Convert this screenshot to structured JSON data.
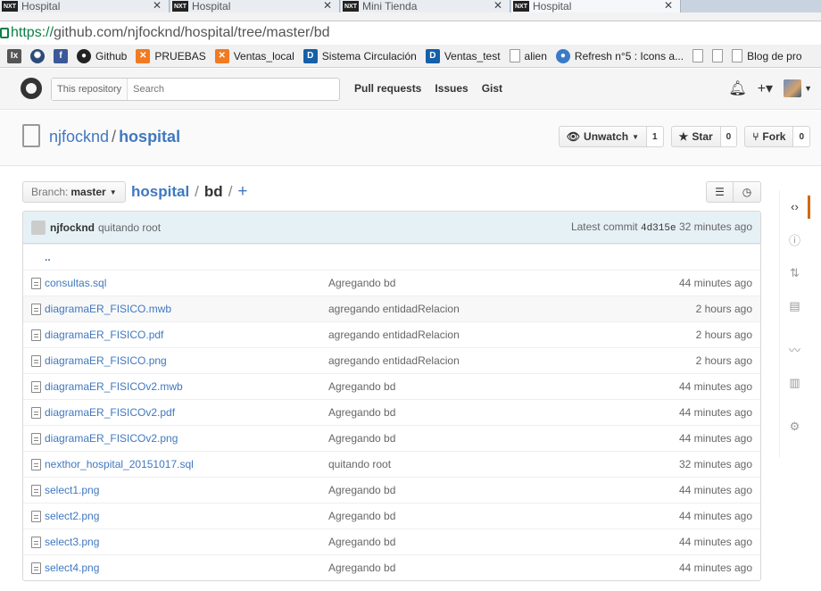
{
  "browser": {
    "tabs": [
      {
        "label": "Hospital",
        "favicon": "NXT"
      },
      {
        "label": "Hospital",
        "favicon": "NXT"
      },
      {
        "label": "Mini Tienda",
        "favicon": "NXT"
      },
      {
        "label": "Hospital",
        "favicon": "NXT"
      }
    ],
    "url_scheme": "https://",
    "url_rest": "github.com/njfocknd/hospital/tree/master/bd",
    "bookmarks": [
      {
        "label": "",
        "icon": "ix-icon"
      },
      {
        "label": "",
        "icon": "globe-icon"
      },
      {
        "label": "",
        "icon": "facebook-icon"
      },
      {
        "label": "Github",
        "icon": "github-icon"
      },
      {
        "label": "PRUEBAS",
        "icon": "xampp-icon"
      },
      {
        "label": "Ventas_local",
        "icon": "xampp-icon"
      },
      {
        "label": "Sistema Circulación",
        "icon": "d-icon"
      },
      {
        "label": "Ventas_test",
        "icon": "d-icon"
      },
      {
        "label": "alien",
        "icon": "page-icon"
      },
      {
        "label": "Refresh n°5 : Icons a...",
        "icon": "globe-icon"
      },
      {
        "label": "",
        "icon": "page-icon"
      },
      {
        "label": "",
        "icon": "page-icon"
      },
      {
        "label": "Blog de pro",
        "icon": "page-icon"
      }
    ]
  },
  "header": {
    "search_scope": "This repository",
    "search_placeholder": "Search",
    "nav": [
      "Pull requests",
      "Issues",
      "Gist"
    ]
  },
  "repo": {
    "owner": "njfocknd",
    "separator": "/",
    "name": "hospital",
    "unwatch_label": "Unwatch",
    "unwatch_count": "1",
    "star_label": "Star",
    "star_count": "0",
    "fork_label": "Fork",
    "fork_count": "0"
  },
  "path": {
    "branch_label": "Branch:",
    "branch": "master",
    "root": "hospital",
    "current": "bd",
    "slash": "/",
    "add": "+"
  },
  "commit": {
    "author": "njfocknd",
    "message": "quitando root",
    "latest_label": "Latest commit",
    "sha": "4d315e",
    "age": "32 minutes ago"
  },
  "up_dir": "..",
  "files": [
    {
      "name": "consultas.sql",
      "message": "Agregando bd",
      "age": "44 minutes ago"
    },
    {
      "name": "diagramaER_FISICO.mwb",
      "message": "agregando entidadRelacion",
      "age": "2 hours ago"
    },
    {
      "name": "diagramaER_FISICO.pdf",
      "message": "agregando entidadRelacion",
      "age": "2 hours ago"
    },
    {
      "name": "diagramaER_FISICO.png",
      "message": "agregando entidadRelacion",
      "age": "2 hours ago"
    },
    {
      "name": "diagramaER_FISICOv2.mwb",
      "message": "Agregando bd",
      "age": "44 minutes ago"
    },
    {
      "name": "diagramaER_FISICOv2.pdf",
      "message": "Agregando bd",
      "age": "44 minutes ago"
    },
    {
      "name": "diagramaER_FISICOv2.png",
      "message": "Agregando bd",
      "age": "44 minutes ago"
    },
    {
      "name": "nexthor_hospital_20151017.sql",
      "message": "quitando root",
      "age": "32 minutes ago"
    },
    {
      "name": "select1.png",
      "message": "Agregando bd",
      "age": "44 minutes ago"
    },
    {
      "name": "select2.png",
      "message": "Agregando bd",
      "age": "44 minutes ago"
    },
    {
      "name": "select3.png",
      "message": "Agregando bd",
      "age": "44 minutes ago"
    },
    {
      "name": "select4.png",
      "message": "Agregando bd",
      "age": "44 minutes ago"
    }
  ],
  "sidebar": [
    "code-icon",
    "issues-icon",
    "pull-request-icon",
    "wiki-icon",
    "pulse-icon",
    "graphs-icon",
    "settings-icon"
  ]
}
